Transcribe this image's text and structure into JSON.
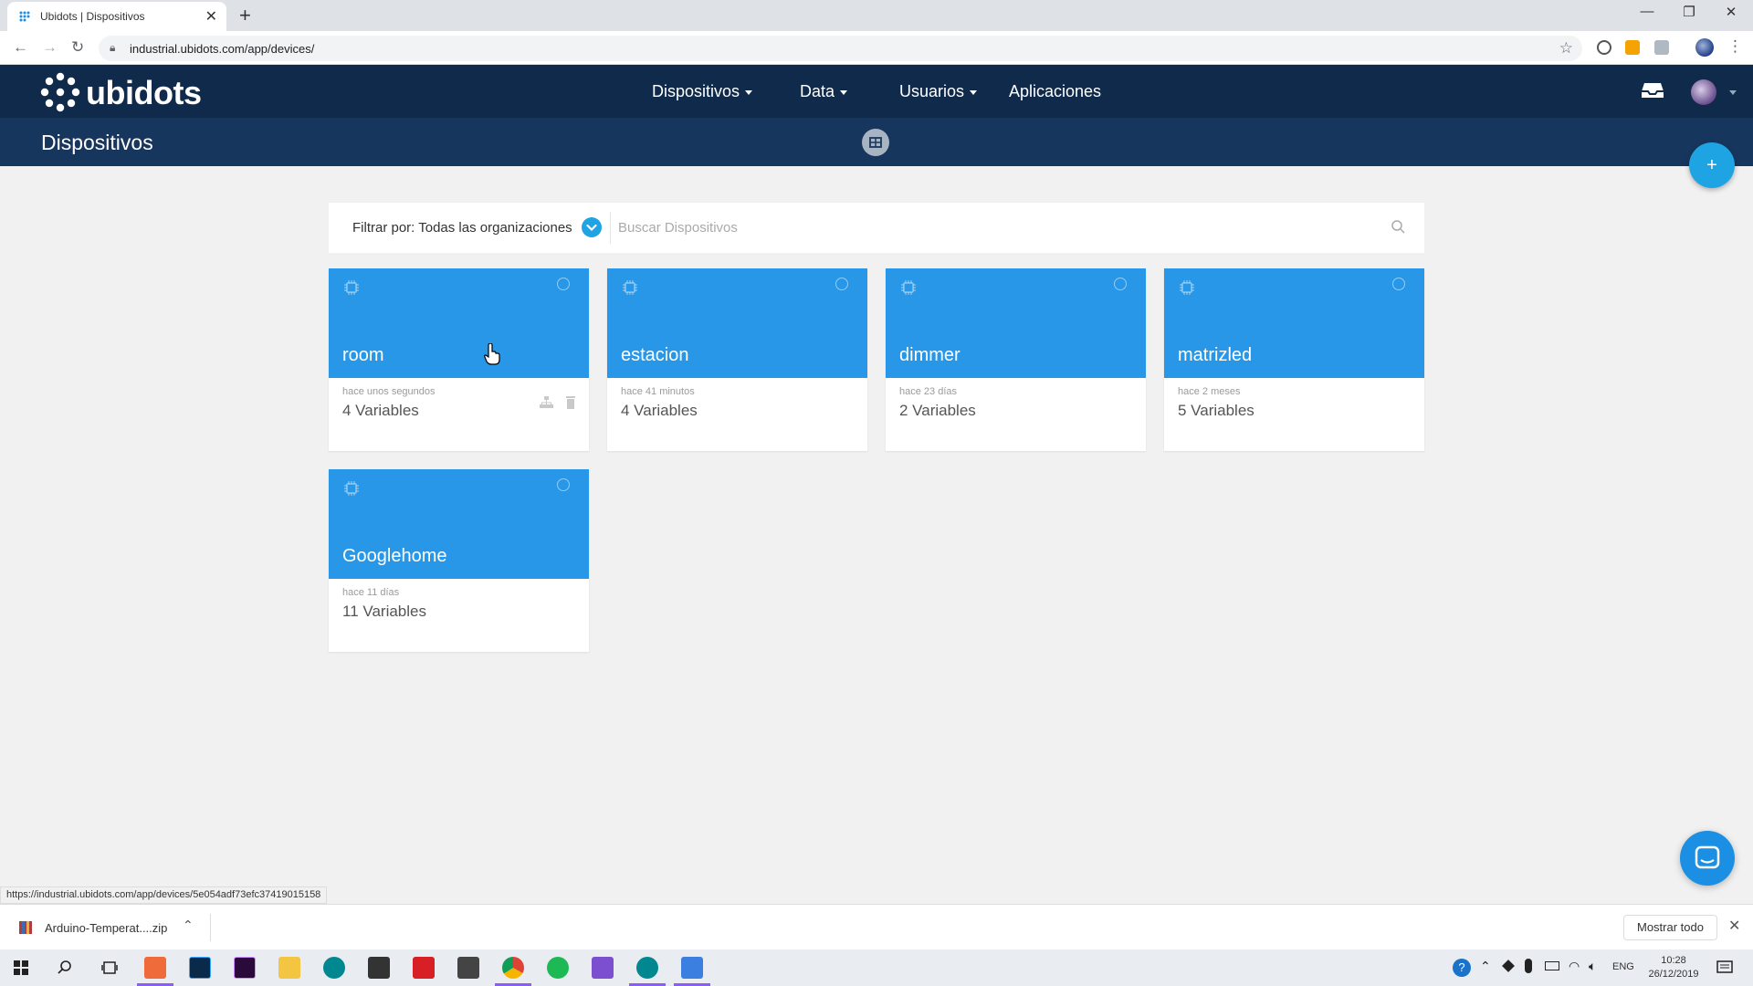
{
  "browser": {
    "tab_title": "Ubidots | Dispositivos",
    "url": "industrial.ubidots.com/app/devices/"
  },
  "navbar": {
    "logo_text": "ubidots",
    "items": [
      {
        "label": "Dispositivos",
        "has_caret": true
      },
      {
        "label": "Data",
        "has_caret": true
      },
      {
        "label": "Usuarios",
        "has_caret": true
      },
      {
        "label": "Aplicaciones",
        "has_caret": false
      }
    ]
  },
  "subheader": {
    "title": "Dispositivos",
    "add_label": "+"
  },
  "filter": {
    "label": "Filtrar por: Todas las organizaciones",
    "search_placeholder": "Buscar Dispositivos"
  },
  "devices": [
    {
      "name": "room",
      "last_activity": "hace unos segundos",
      "variables": "4 Variables"
    },
    {
      "name": "estacion",
      "last_activity": "hace 41 minutos",
      "variables": "4 Variables"
    },
    {
      "name": "dimmer",
      "last_activity": "hace 23 días",
      "variables": "2 Variables"
    },
    {
      "name": "matrizled",
      "last_activity": "hace 2 meses",
      "variables": "5 Variables"
    },
    {
      "name": "Googlehome",
      "last_activity": "hace 11 días",
      "variables": "11 Variables"
    }
  ],
  "status_url": "https://industrial.ubidots.com/app/devices/5e054adf73efc37419015158",
  "download": {
    "file_name": "Arduino-Temperat....zip",
    "show_all": "Mostrar todo"
  },
  "taskbar": {
    "language": "ENG",
    "time": "10:28",
    "date": "26/12/2019"
  },
  "colors": {
    "navbar": "#0f2a4a",
    "subheader": "#17365e",
    "card_header": "#2897e8",
    "accent": "#1ea3e3"
  }
}
